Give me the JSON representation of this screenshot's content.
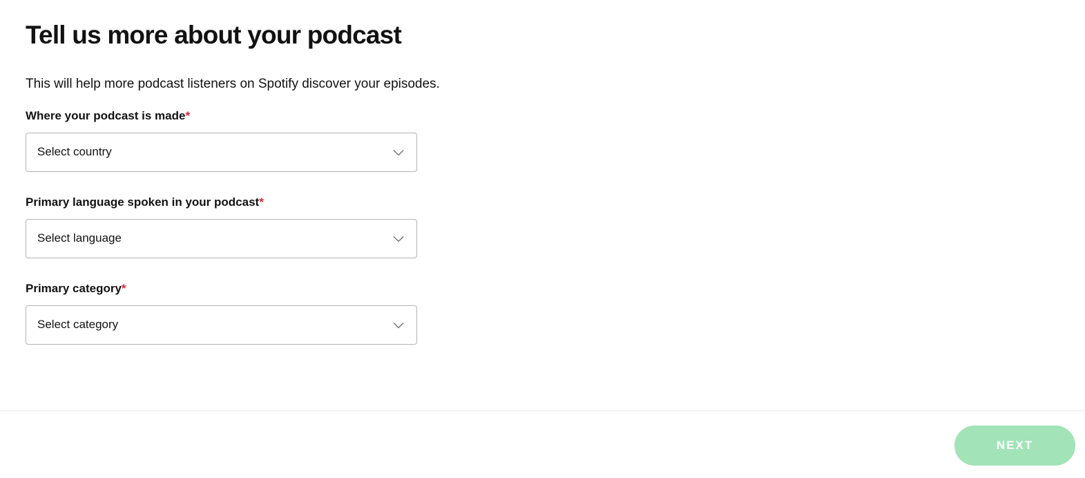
{
  "header": {
    "title": "Tell us more about your podcast",
    "subtitle": "This will help more podcast listeners on Spotify discover your episodes."
  },
  "form": {
    "required_marker": "*",
    "country": {
      "label": "Where your podcast is made",
      "value": "Select country",
      "icon": "chevron-down-icon"
    },
    "language": {
      "label": "Primary language spoken in your podcast",
      "value": "Select language",
      "icon": "chevron-down-icon"
    },
    "category": {
      "label": "Primary category",
      "value": "Select category",
      "icon": "chevron-down-icon"
    }
  },
  "footer": {
    "next_label": "NEXT",
    "next_color": "#a2e3b8"
  },
  "colors": {
    "required": "#e22134",
    "text": "#121212",
    "border": "#b3b3b3"
  }
}
